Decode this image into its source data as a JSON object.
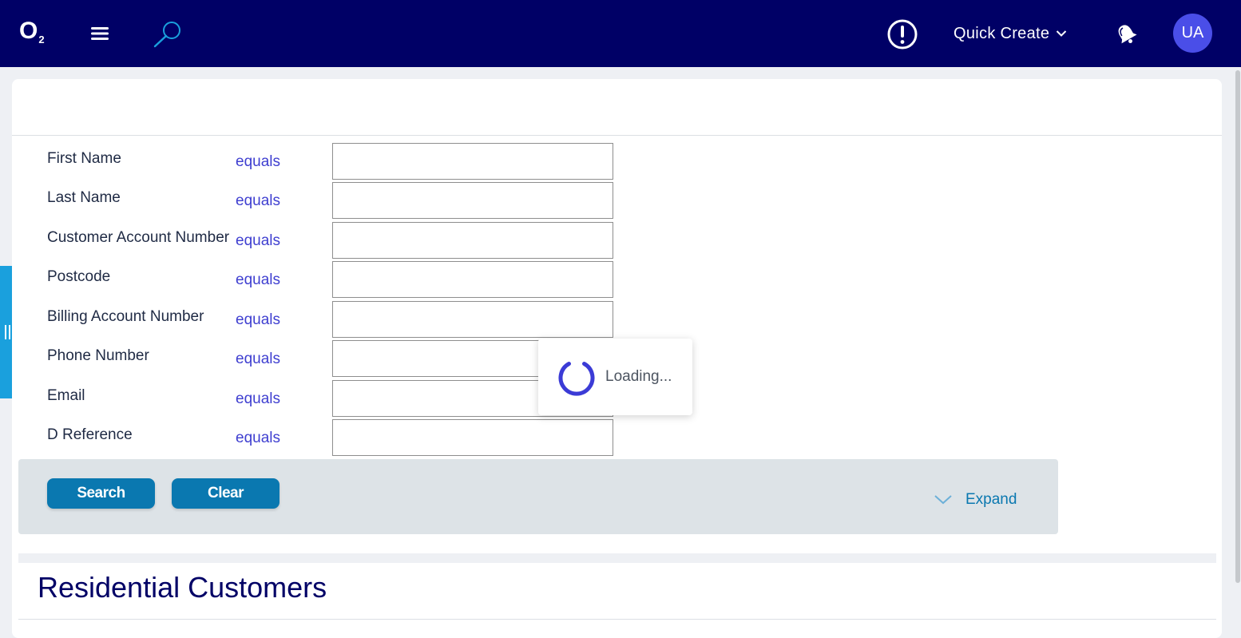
{
  "header": {
    "logo": "O",
    "logo_sub": "2",
    "quick_create_label": "Quick Create",
    "avatar_initials": "UA"
  },
  "search_form": {
    "fields": [
      {
        "label": "First Name",
        "operator": "equals",
        "value": ""
      },
      {
        "label": "Last Name",
        "operator": "equals",
        "value": ""
      },
      {
        "label": "Customer Account Number",
        "operator": "equals",
        "value": ""
      },
      {
        "label": "Postcode",
        "operator": "equals",
        "value": ""
      },
      {
        "label": "Billing Account Number",
        "operator": "equals",
        "value": ""
      },
      {
        "label": "Phone Number",
        "operator": "equals",
        "value": ""
      },
      {
        "label": "Email",
        "operator": "equals",
        "value": ""
      },
      {
        "label": "D Reference",
        "operator": "equals",
        "value": ""
      }
    ],
    "search_label": "Search",
    "clear_label": "Clear",
    "expand_label": "Expand"
  },
  "section": {
    "title": "Residential Customers"
  },
  "loading": {
    "text": "Loading..."
  },
  "colors": {
    "header_bg": "#000066",
    "accent": "#0a78b0",
    "operator": "#3f3fd0",
    "side_handle": "#1aa0dd",
    "avatar_bg": "#4a4ee8"
  }
}
